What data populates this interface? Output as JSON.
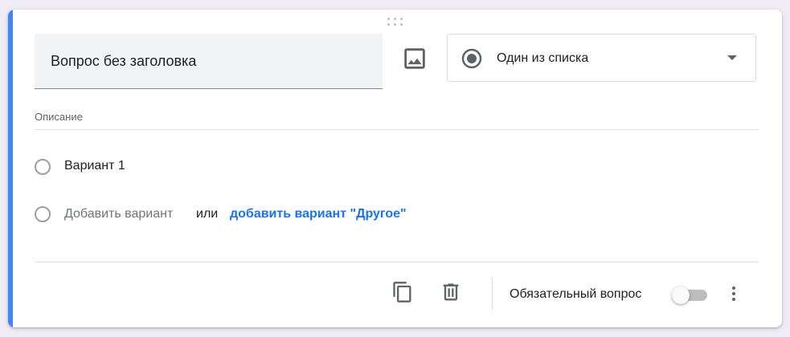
{
  "question": {
    "title_placeholder": "Вопрос без заголовка",
    "description_label": "Описание"
  },
  "type_select": {
    "selected": "Один из списка",
    "icon": "radio-checked-icon"
  },
  "options": [
    {
      "label": "Вариант 1"
    }
  ],
  "add_option": {
    "label": "Добавить вариант",
    "or": "или",
    "other_link": "добавить вариант \"Другое\""
  },
  "footer": {
    "required_label": "Обязательный вопрос",
    "required_on": false,
    "icons": [
      "copy-icon",
      "trash-icon",
      "more-vert-icon"
    ]
  },
  "colors": {
    "accent": "#4285f4",
    "link": "#1a73e8"
  }
}
